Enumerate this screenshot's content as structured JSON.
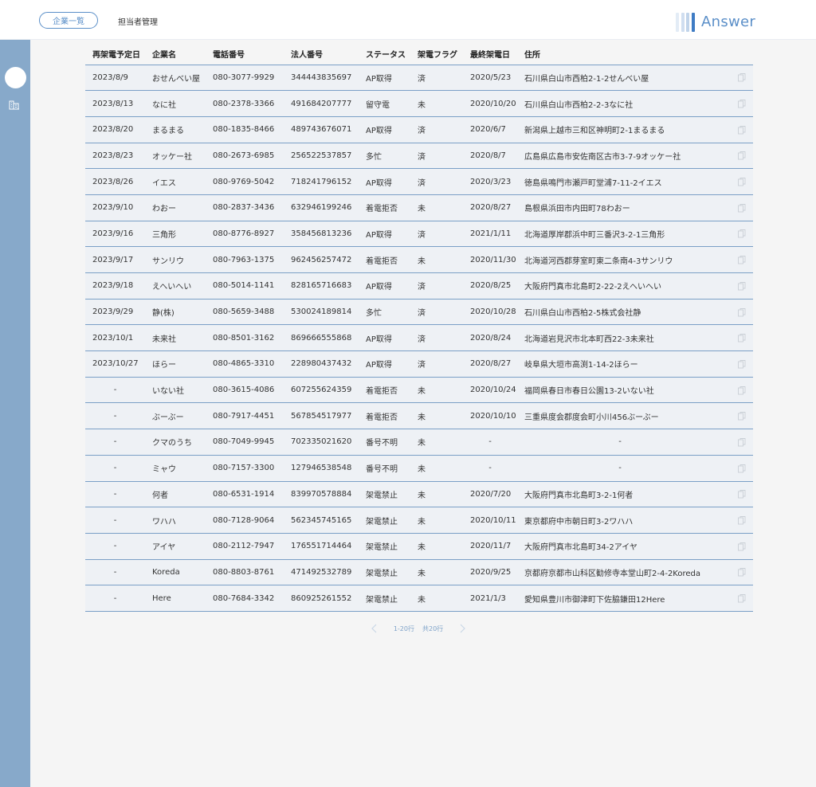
{
  "header": {
    "nav_company_list": "企業一覧",
    "nav_staff": "担当者管理",
    "logo_text": "Answer"
  },
  "colors": {
    "accent": "#5b8fc8",
    "sidebar": "#87a9ca",
    "row_bg": "#eef1f5",
    "divider": "#7a9fc6"
  },
  "sidebar": {
    "icons": [
      "avatar",
      "building-icon"
    ]
  },
  "table": {
    "headers": [
      "再架電予定日",
      "企業名",
      "電話番号",
      "法人番号",
      "ステータス",
      "架電フラグ",
      "最終架電日",
      "住所"
    ],
    "rows": [
      [
        "2023/8/9",
        "おせんべい屋",
        "080-3077-9929",
        "344443835697",
        "AP取得",
        "済",
        "2020/5/23",
        "石川県白山市西柏2-1-2せんべい屋"
      ],
      [
        "2023/8/13",
        "なに社",
        "080-2378-3366",
        "491684207777",
        "留守電",
        "未",
        "2020/10/20",
        "石川県白山市西柏2-2-3なに社"
      ],
      [
        "2023/8/20",
        "まるまる",
        "080-1835-8466",
        "489743676071",
        "AP取得",
        "済",
        "2020/6/7",
        "新潟県上越市三和区神明町2-1まるまる"
      ],
      [
        "2023/8/23",
        "オッケー社",
        "080-2673-6985",
        "256522537857",
        "多忙",
        "済",
        "2020/8/7",
        "広島県広島市安佐南区古市3-7-9オッケー社"
      ],
      [
        "2023/8/26",
        "イエス",
        "080-9769-5042",
        "718241796152",
        "AP取得",
        "済",
        "2020/3/23",
        "徳島県鳴門市瀬戸町堂浦7-11-2イエス"
      ],
      [
        "2023/9/10",
        "わおー",
        "080-2837-3436",
        "632946199246",
        "着電拒否",
        "未",
        "2020/8/27",
        "島根県浜田市内田町78わおー"
      ],
      [
        "2023/9/16",
        "三角形",
        "080-8776-8927",
        "358456813236",
        "AP取得",
        "済",
        "2021/1/11",
        "北海道厚岸郡浜中町三番沢3-2-1三角形"
      ],
      [
        "2023/9/17",
        "サンリウ",
        "080-7963-1375",
        "962456257472",
        "着電拒否",
        "未",
        "2020/11/30",
        "北海道河西郡芽室町東二条南4-3サンリウ"
      ],
      [
        "2023/9/18",
        "えへいへい",
        "080-5014-1141",
        "828165716683",
        "AP取得",
        "済",
        "2020/8/25",
        "大阪府門真市北島町2-22-2えへいへい"
      ],
      [
        "2023/9/29",
        "静(株)",
        "080-5659-3488",
        "530024189814",
        "多忙",
        "済",
        "2020/10/28",
        "石川県白山市西柏2-5株式会社静"
      ],
      [
        "2023/10/1",
        "未来社",
        "080-8501-3162",
        "869666555868",
        "AP取得",
        "済",
        "2020/8/24",
        "北海道岩見沢市北本町西22-3未来社"
      ],
      [
        "2023/10/27",
        "ほらー",
        "080-4865-3310",
        "228980437432",
        "AP取得",
        "済",
        "2020/8/27",
        "岐阜県大垣市高渕1-14-2ほらー"
      ],
      [
        "-",
        "いない社",
        "080-3615-4086",
        "607255624359",
        "着電拒否",
        "未",
        "2020/10/24",
        "福岡県春日市春日公園13-2いない社"
      ],
      [
        "-",
        "ぶーぶー",
        "080-7917-4451",
        "567854517977",
        "着電拒否",
        "未",
        "2020/10/10",
        "三重県度会郡度会町小川456ぶーぶー"
      ],
      [
        "-",
        "クマのうち",
        "080-7049-9945",
        "702335021620",
        "番号不明",
        "未",
        "-",
        "-"
      ],
      [
        "-",
        "ミャウ",
        "080-7157-3300",
        "127946538548",
        "番号不明",
        "未",
        "-",
        "-"
      ],
      [
        "-",
        "何者",
        "080-6531-1914",
        "839970578884",
        "架電禁止",
        "未",
        "2020/7/20",
        "大阪府門真市北島町3-2-1何者"
      ],
      [
        "-",
        "ワハハ",
        "080-7128-9064",
        "562345745165",
        "架電禁止",
        "未",
        "2020/10/11",
        "東京都府中市朝日町3-2ワハハ"
      ],
      [
        "-",
        "アイヤ",
        "080-2112-7947",
        "176551714464",
        "架電禁止",
        "未",
        "2020/11/7",
        "大阪府門真市北島町34-2アイヤ"
      ],
      [
        "-",
        "Koreda",
        "080-8803-8761",
        "471492532789",
        "架電禁止",
        "未",
        "2020/9/25",
        "京都府京都市山科区勧修寺本堂山町2-4-2Koreda"
      ],
      [
        "-",
        "Here",
        "080-7684-3342",
        "860925261552",
        "架電禁止",
        "未",
        "2021/1/3",
        "愛知県豊川市御津町下佐脇鎌田12Here"
      ]
    ]
  },
  "pagination": {
    "range": "1-20行",
    "total": "共20行"
  }
}
